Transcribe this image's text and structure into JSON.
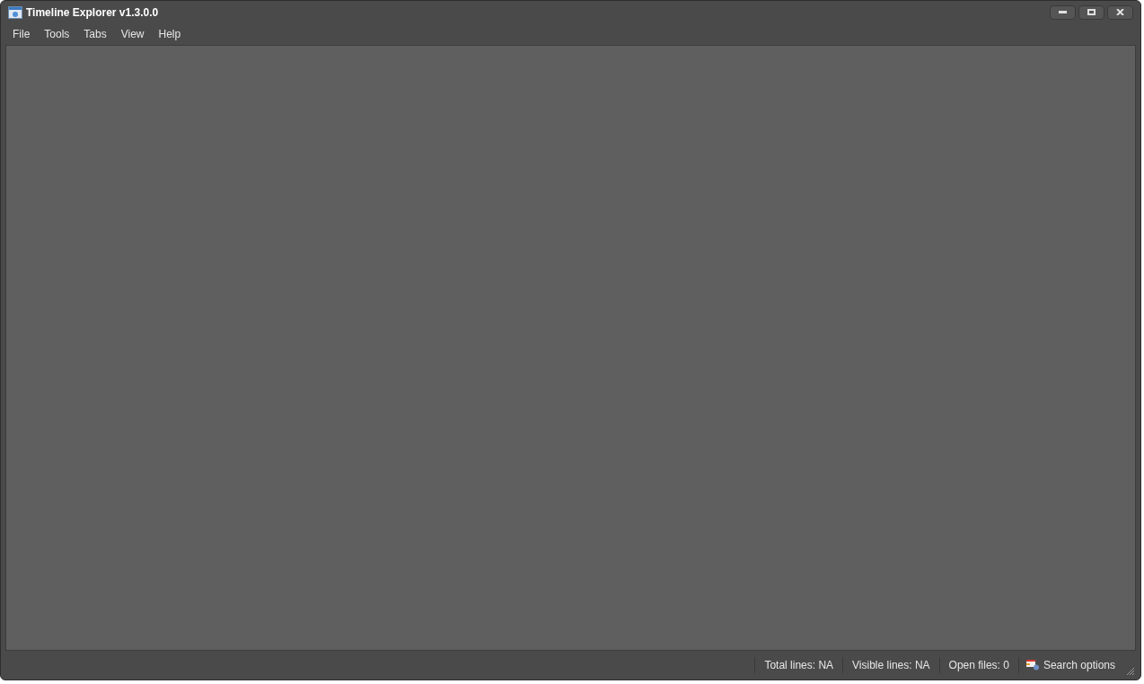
{
  "window": {
    "title": "Timeline Explorer v1.3.0.0"
  },
  "menu": [
    "File",
    "Tools",
    "Tabs",
    "View",
    "Help"
  ],
  "status_bar": {
    "items": [
      "Total lines: NA",
      "Visible lines: NA",
      "Open files: 0"
    ],
    "search_options": "Search options"
  }
}
